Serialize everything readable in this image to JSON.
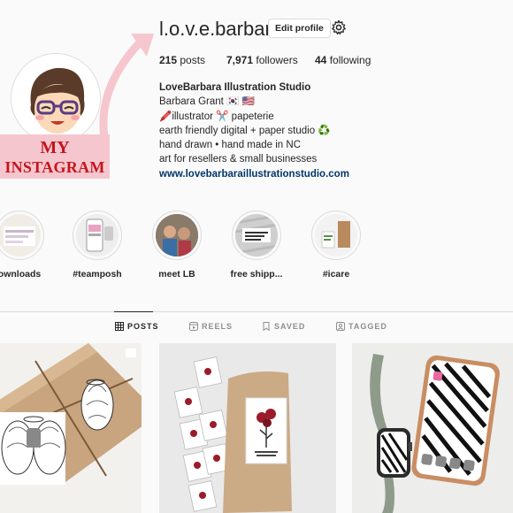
{
  "profile": {
    "username": "l.o.v.e.barbara",
    "edit_label": "Edit profile",
    "stats": [
      {
        "count": "215",
        "label": "posts"
      },
      {
        "count": "7,971",
        "label": "followers"
      },
      {
        "count": "44",
        "label": "following"
      }
    ]
  },
  "bio": {
    "name": "LoveBarbara Illustration Studio",
    "line1": "Barbara Grant 🇰🇷 🇺🇸",
    "line2": "🖍️illustrator ✂️ papeterie",
    "line3": "earth friendly digital + paper studio ♻️",
    "line4": "hand drawn • hand made in NC",
    "line5": "art for resellers & small businesses",
    "link": "www.lovebarbaraillustrationstudio.com"
  },
  "badge": {
    "line1": "MY",
    "line2": "INSTAGRAM"
  },
  "highlights": [
    {
      "label": "ownloads"
    },
    {
      "label": "#teamposh"
    },
    {
      "label": "meet LB"
    },
    {
      "label": "free shipp..."
    },
    {
      "label": "#icare"
    }
  ],
  "tabs": [
    {
      "label": "POSTS",
      "icon": "grid-icon"
    },
    {
      "label": "REELS",
      "icon": "reels-icon"
    },
    {
      "label": "SAVED",
      "icon": "bookmark-icon"
    },
    {
      "label": "TAGGED",
      "icon": "tag-icon"
    }
  ]
}
